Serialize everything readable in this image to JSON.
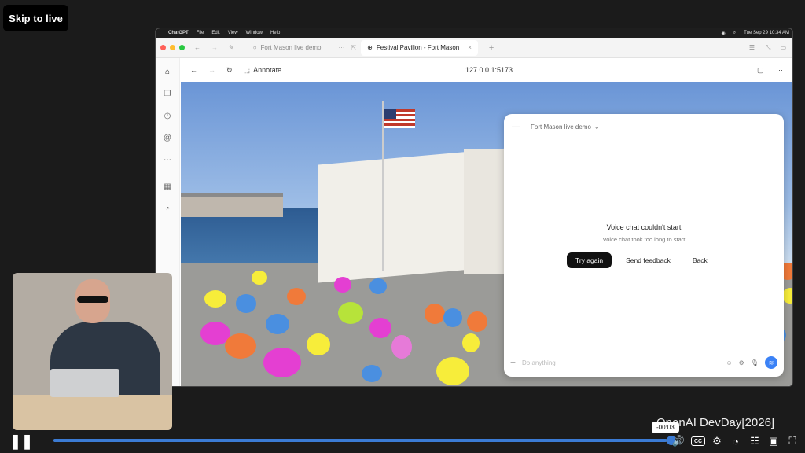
{
  "skip_label": "Skip to live",
  "menubar": {
    "app": "ChatGPT",
    "items": [
      "File",
      "Edit",
      "View",
      "Window",
      "Help"
    ],
    "clock": "Tue Sep 29  10:34 AM"
  },
  "tabs": [
    {
      "label": "Fort Mason live demo",
      "active": false
    },
    {
      "label": "Festival Pavilion - Fort Mason",
      "active": true
    }
  ],
  "toolbar": {
    "annotate_label": "Annotate",
    "url": "127.0.0.1:5173"
  },
  "chat": {
    "title": "Fort Mason live demo",
    "error_title": "Voice chat couldn't start",
    "error_subtitle": "Voice chat took too long to start",
    "try_again": "Try again",
    "send_feedback": "Send feedback",
    "back": "Back",
    "composer_placeholder": "Do anything"
  },
  "watermark": "OpenAI DevDay[2026]",
  "player": {
    "time_tooltip": "-00:03",
    "progress_fraction": 0.997,
    "cc_label": "CC"
  },
  "colors": {
    "accent_blue": "#3b7bd4",
    "primary_button": "#111111"
  }
}
